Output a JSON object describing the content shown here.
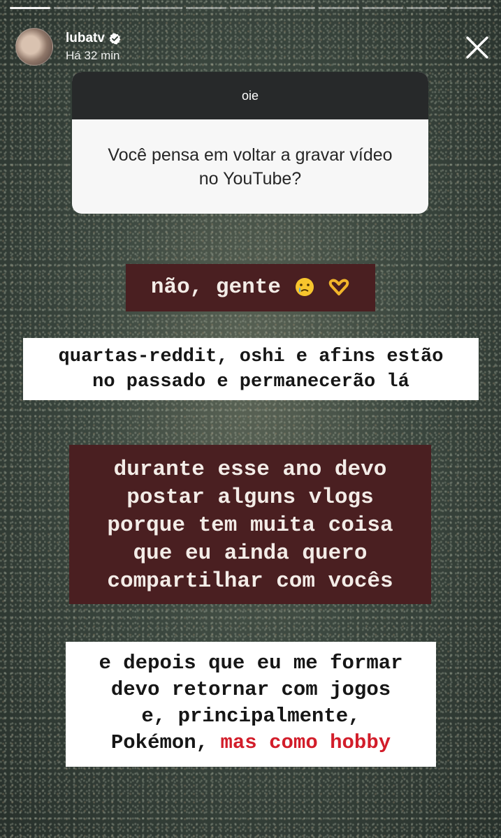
{
  "story": {
    "username": "lubatv",
    "time_ago": "Há 32 min",
    "progress": {
      "segments": 11,
      "current": 1
    }
  },
  "question_box": {
    "header": "oie",
    "question_line1": "Você pensa em voltar a gravar vídeo",
    "question_line2": "no YouTube?"
  },
  "captions": {
    "c1": {
      "text": "não, gente",
      "emojis": [
        "crying-face-icon",
        "heart-hands-icon"
      ]
    },
    "c2": {
      "line1": "quartas-reddit, oshi e afins estão",
      "line2": "no passado e permanecerão lá"
    },
    "c3": {
      "line1": "durante esse ano devo",
      "line2": "postar alguns vlogs",
      "line3": "porque tem muita coisa",
      "line4": "que eu ainda quero",
      "line5": "compartilhar com vocês"
    },
    "c4": {
      "line1": "e depois que eu me formar",
      "line2": "devo retornar com jogos",
      "line3": "e, principalmente,",
      "line4_plain": "Pokémon,",
      "line4_red": "mas como hobby"
    }
  },
  "colors": {
    "caption_dark_bg": "#4a1f21",
    "caption_light_bg": "#ffffff",
    "highlight_red": "#d21d2a",
    "question_header_bg": "#27292a"
  }
}
